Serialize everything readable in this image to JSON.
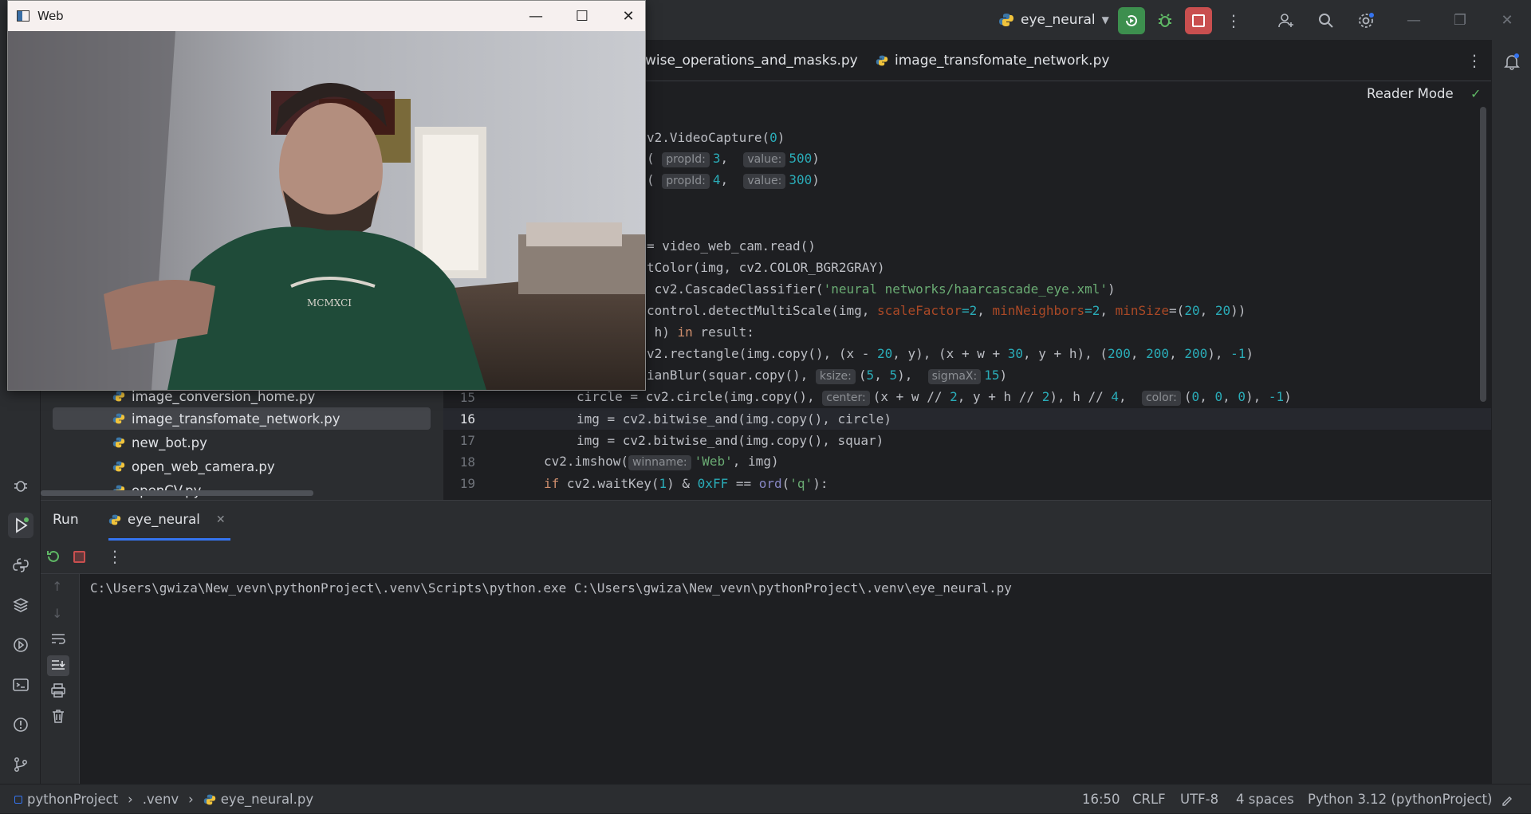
{
  "titlebar": {
    "run_config": "eye_neural"
  },
  "project_tree": {
    "items": [
      {
        "label": "image_conversion_home.py",
        "selected": false
      },
      {
        "label": "image_transfomate_network.py",
        "selected": true
      },
      {
        "label": "new_bot.py",
        "selected": false
      },
      {
        "label": "open_web_camera.py",
        "selected": false
      },
      {
        "label": "openCV.py",
        "selected": false
      }
    ]
  },
  "editor": {
    "tabs": [
      {
        "label": "wise_operations_and_masks.py"
      },
      {
        "label": "image_transfomate_network.py"
      }
    ],
    "reader_mode": "Reader Mode",
    "lines": {
      "l1": "v2.VideoCapture(",
      "l1n": "0",
      "l2a": "(",
      "l2h1": "propId:",
      "l2n1": "3",
      "l2h2": "value:",
      "l2n2": "500",
      "l3a": "(",
      "l3h1": "propId:",
      "l3n1": "4",
      "l3h2": "value:",
      "l3n2": "300",
      "l4": "= video_web_cam.read()",
      "l5": "tColor(img, cv2.COLOR_BGR2GRAY)",
      "l6a": " cv2.CascadeClassifier(",
      "l6s": "'neural networks/haarcascade_eye.xml'",
      "l6b": ")",
      "l7a": "control.detectMultiScale(img, ",
      "l7p1": "scaleFactor",
      "l7n1": "=2",
      "l7p2": "minNeighbors",
      "l7n2": "=2",
      "l7p3": "minSize",
      "l7c": "=(",
      "l7n3": "20",
      "l7n4": "20",
      "l8a": " h) ",
      "l8k": "in",
      "l8b": " result:",
      "l9a": "v2.rectangle(img.copy(), (x - ",
      "l9n1": "20",
      "l9b": ", y), (x + w + ",
      "l9n2": "30",
      "l9c": ", y + h), (",
      "l9n3": "200",
      "l9n4": "200",
      "l9n5": "200",
      "l9n6": "-1",
      "l10a": "ianBlur(squar.copy(), ",
      "l10h1": "ksize:",
      "l10b": "(",
      "l10n1": "5",
      "l10n2": "5",
      "l10h2": "sigmaX:",
      "l10n3": "15",
      "l15_num": "15",
      "l15a": "circle = cv2.circle(img.copy(), ",
      "l15h1": "center:",
      "l15b": "(x + w // ",
      "l15n1": "2",
      "l15c": ", y + h // ",
      "l15n2": "2",
      "l15d": "), h // ",
      "l15n3": "4",
      "l15h2": "color:",
      "l15n4": "0",
      "l15n5": "0",
      "l15n6": "0",
      "l15n7": "-1",
      "l16_num": "16",
      "l16": "img = cv2.bitwise_and(img.copy(), circle)",
      "l17_num": "17",
      "l17": "img = cv2.bitwise_and(img.copy(), squar)",
      "l18_num": "18",
      "l18a": "cv2.imshow(",
      "l18h": "winname:",
      "l18s": "'Web'",
      "l18b": ", img)",
      "l19_num": "19",
      "l19k": "if",
      "l19a": " cv2.waitKey(",
      "l19n1": "1",
      "l19b": ") & ",
      "l19n2": "0xFF",
      "l19c": " == ",
      "l19bi": "ord",
      "l19d": "(",
      "l19s": "'q'",
      "l19e": "):"
    }
  },
  "run_panel": {
    "title": "Run",
    "tab_label": "eye_neural",
    "console_text": "C:\\Users\\gwiza\\New_vevn\\pythonProject\\.venv\\Scripts\\python.exe C:\\Users\\gwiza\\New_vevn\\pythonProject\\.venv\\eye_neural.py"
  },
  "statusbar": {
    "project": "pythonProject",
    "folder": ".venv",
    "file": "eye_neural.py",
    "position": "16:50",
    "line_sep": "CRLF",
    "encoding": "UTF-8",
    "indent": "4 spaces",
    "interpreter": "Python 3.12 (pythonProject)"
  },
  "webcam_window": {
    "title": "Web"
  },
  "colors": {
    "accent_green": "#3d8f4e",
    "stop_red": "#c94f4f",
    "editor_bg": "#1e1f22",
    "panel_bg": "#2b2d30"
  }
}
